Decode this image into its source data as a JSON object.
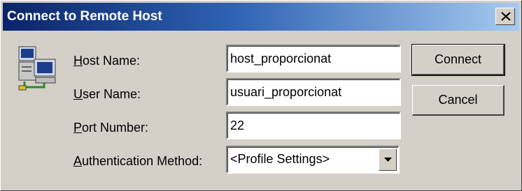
{
  "window": {
    "title": "Connect to Remote Host",
    "close_glyph": "×"
  },
  "form": {
    "host_label": {
      "mnemonic": "H",
      "rest": "ost Name:"
    },
    "user_label": {
      "mnemonic": "U",
      "rest": "ser Name:"
    },
    "port_label": {
      "mnemonic": "P",
      "rest": "ort Number:"
    },
    "auth_label": {
      "mnemonic": "A",
      "rest": "uthentication Method:"
    },
    "host_value": "host_proporcionat",
    "user_value": "usuari_proporcionat",
    "port_value": "22",
    "auth_value": "<Profile Settings>"
  },
  "buttons": {
    "connect": "Connect",
    "cancel": "Cancel"
  },
  "icons": {
    "app": "networked-computers-icon",
    "close": "close-icon",
    "dropdown": "dropdown-arrow-icon"
  },
  "colors": {
    "title_start": "#0a246a",
    "title_end": "#a6caf0",
    "face": "#d4d0c8"
  }
}
